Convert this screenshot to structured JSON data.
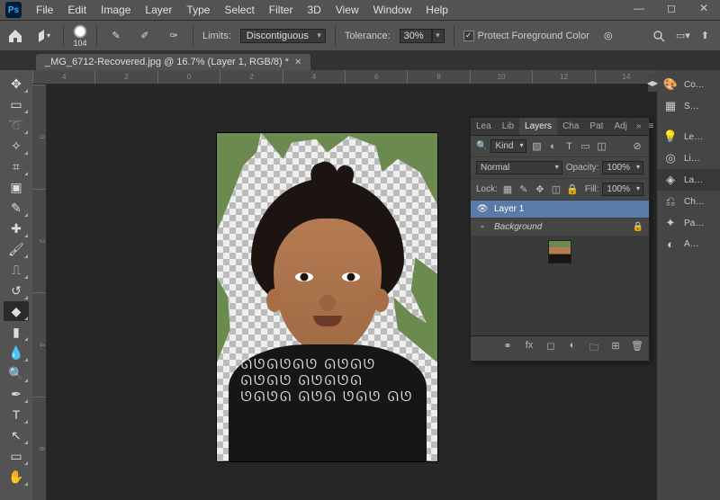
{
  "menu": [
    "File",
    "Edit",
    "Image",
    "Layer",
    "Type",
    "Select",
    "Filter",
    "3D",
    "View",
    "Window",
    "Help"
  ],
  "options": {
    "brush_size": "104",
    "limits_label": "Limits:",
    "limits_value": "Discontiguous",
    "tolerance_label": "Tolerance:",
    "tolerance_value": "30%",
    "protect_label": "Protect Foreground Color"
  },
  "doc": {
    "title": "_MG_6712-Recovered.jpg @ 16.7% (Layer 1, RGB/8) *"
  },
  "ruler_top": [
    "4",
    "2",
    "0",
    "2",
    "4",
    "6",
    "8",
    "10",
    "12",
    "14"
  ],
  "ruler_left": [
    "0",
    "2",
    "4",
    "6"
  ],
  "layers_panel": {
    "tabs": [
      "Lea",
      "Lib",
      "Layers",
      "Cha",
      "Pat",
      "Adj"
    ],
    "kind_label": "Kind",
    "blend_mode": "Normal",
    "opacity_label": "Opacity:",
    "opacity_value": "100%",
    "lock_label": "Lock:",
    "fill_label": "Fill:",
    "fill_value": "100%",
    "layers": [
      {
        "name": "Layer 1",
        "visible": true,
        "selected": true,
        "locked": false
      },
      {
        "name": "Background",
        "visible": false,
        "selected": false,
        "locked": true
      }
    ]
  },
  "right_bar": [
    {
      "icon": "🎨",
      "label": "Co…"
    },
    {
      "icon": "▦",
      "label": "S…"
    },
    {
      "icon": "💡",
      "label": "Le…"
    },
    {
      "icon": "◎",
      "label": "Li…"
    },
    {
      "icon": "◈",
      "label": "La…"
    },
    {
      "icon": "⎌",
      "label": "Ch…"
    },
    {
      "icon": "✦",
      "label": "Pa…"
    },
    {
      "icon": "◐",
      "label": "A…"
    }
  ]
}
